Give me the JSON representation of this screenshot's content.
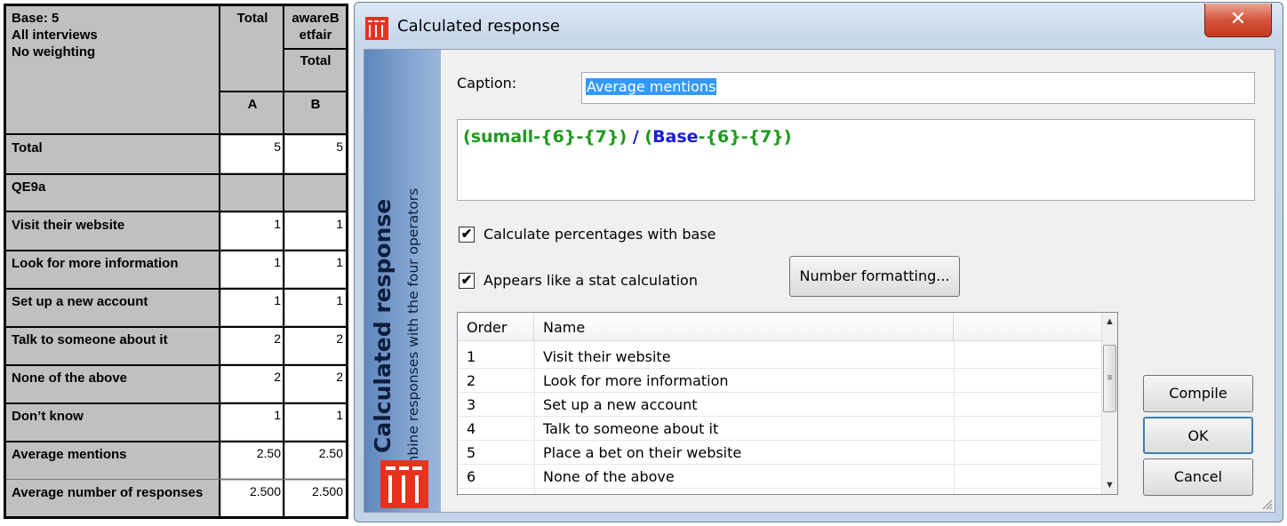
{
  "table": {
    "base_lines": [
      "Base: 5",
      "All interviews",
      "No weighting"
    ],
    "col_total": "Total",
    "col_aware": "awareB etfair",
    "col_aware_sub": "Total",
    "col_letters": [
      "A",
      "B"
    ],
    "section_label": "QE9a",
    "rows": [
      {
        "label": "Total",
        "a": "5",
        "b": "5"
      },
      {
        "label": "Visit their website",
        "a": "1",
        "b": "1"
      },
      {
        "label": "Look for more information",
        "a": "1",
        "b": "1"
      },
      {
        "label": "Set up a new account",
        "a": "1",
        "b": "1"
      },
      {
        "label": "Talk to someone about it",
        "a": "2",
        "b": "2"
      },
      {
        "label": "None of the above",
        "a": "2",
        "b": "2"
      },
      {
        "label": "Don’t know",
        "a": "1",
        "b": "1"
      },
      {
        "label": "Average mentions",
        "a": "2.50",
        "b": "2.50"
      },
      {
        "label": "Average number of responses",
        "a": "2.500",
        "b": "2.500"
      }
    ]
  },
  "dialog": {
    "title": "Calculated response",
    "close_glyph": "✕",
    "banner_title": "Calculated response",
    "banner_subtitle": "Combine responses with the four operators",
    "caption_label": "Caption:",
    "caption_value": "Average mentions",
    "expression": {
      "open1": "(",
      "sumall": "sumall",
      "minus1": "-",
      "ref6a": "{6}",
      "minus2": "-",
      "ref7a": "{7}",
      "close1": ")",
      "divide": " / ",
      "open2": "(",
      "base": "Base",
      "minus3": "-",
      "ref6b": "{6}",
      "minus4": "-",
      "ref7b": "{7}",
      "close2": ")"
    },
    "check_percentages": {
      "label": "Calculate percentages with base",
      "checked": "✔"
    },
    "check_stat": {
      "label": "Appears like a stat calculation",
      "checked": "✔"
    },
    "number_formatting_label": "Number formatting...",
    "list": {
      "columns": [
        "Order",
        "Name"
      ],
      "rows": [
        {
          "order": "1",
          "name": "Visit their website"
        },
        {
          "order": "2",
          "name": "Look for more information"
        },
        {
          "order": "3",
          "name": "Set up a new account"
        },
        {
          "order": "4",
          "name": "Talk to someone about it"
        },
        {
          "order": "5",
          "name": "Place a bet on their website"
        },
        {
          "order": "6",
          "name": "None of the above"
        }
      ]
    },
    "compile_label": "Compile",
    "ok_label": "OK",
    "cancel_label": "Cancel",
    "colors": {
      "green": "#1f9a1f",
      "blue": "#1a1adf",
      "accent_red": "#e8321e"
    }
  }
}
